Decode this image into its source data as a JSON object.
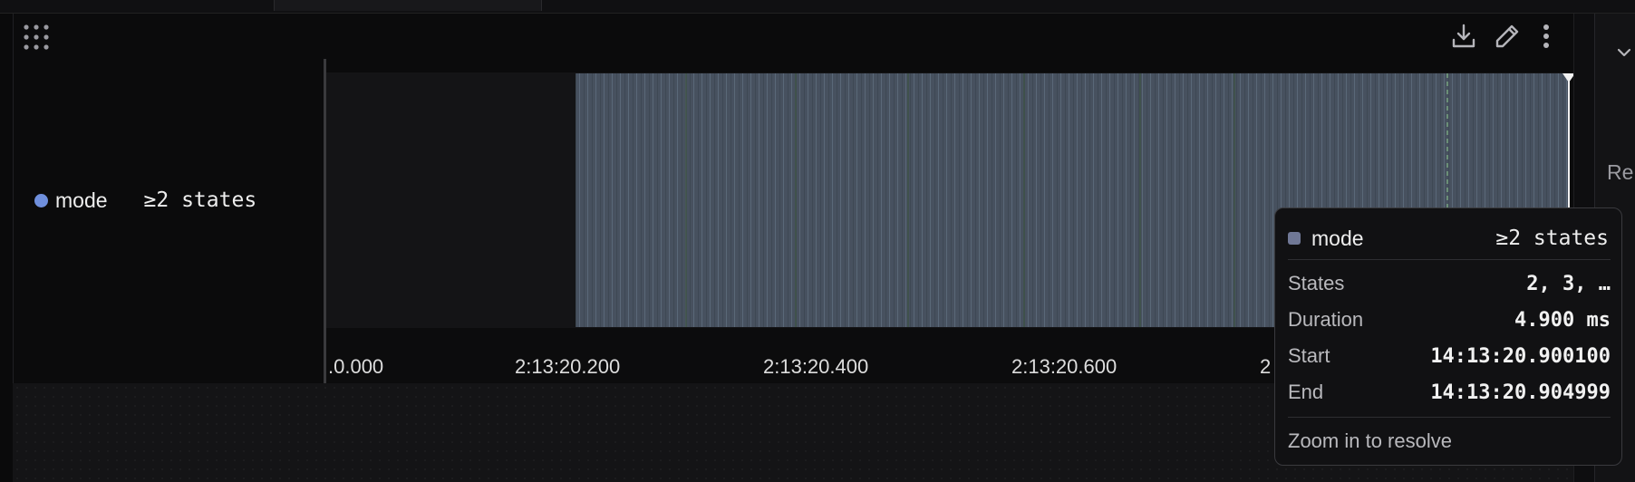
{
  "panel": {
    "toolbar": {
      "drag_icon": "grip-icon",
      "download_icon": "download-icon",
      "edit_icon": "pencil-icon",
      "more_icon": "more-vertical-icon"
    },
    "legend": {
      "series_name": "mode",
      "states_label": "≥2 states",
      "series_color": "#6f8fdd"
    },
    "axis_ticks": [
      ".0.000",
      "2:13:20.200",
      "2:13:20.400",
      "2:13:20.600",
      "2"
    ],
    "tooltip": {
      "series_name": "mode",
      "states_label": "≥2 states",
      "swatch_color": "#707896",
      "rows": [
        {
          "key": "States",
          "value": "2, 3, …"
        },
        {
          "key": "Duration",
          "value": "4.900 ms"
        },
        {
          "key": "Start",
          "value": "14:13:20.900100"
        },
        {
          "key": "End",
          "value": "14:13:20.904999"
        }
      ],
      "footer": "Zoom in to resolve"
    }
  },
  "right_panel": {
    "heading_fragment": "Re"
  }
}
